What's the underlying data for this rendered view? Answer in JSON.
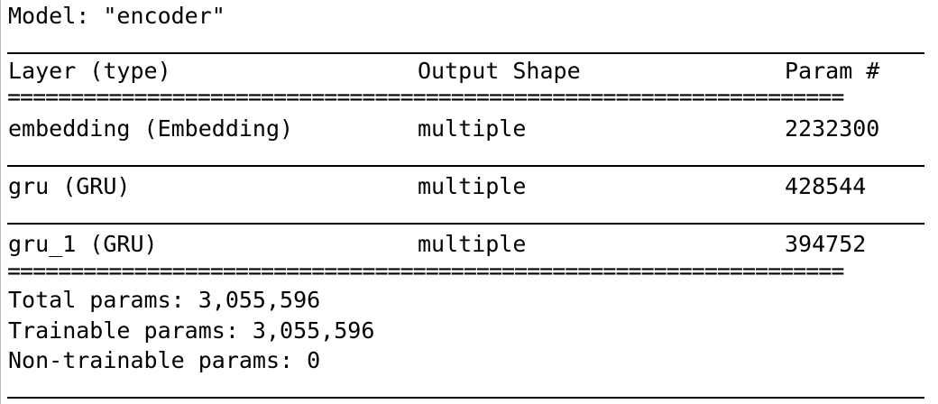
{
  "model_title": "Model: \"encoder\"",
  "table": {
    "headers": {
      "layer": "Layer (type)",
      "output_shape": "Output Shape",
      "params": "Param #"
    },
    "rows": [
      {
        "layer": "embedding (Embedding)",
        "output_shape": "multiple",
        "params": "2232300"
      },
      {
        "layer": "gru (GRU)",
        "output_shape": "multiple",
        "params": "428544"
      },
      {
        "layer": "gru_1 (GRU)",
        "output_shape": "multiple",
        "params": "394752"
      }
    ]
  },
  "summary": {
    "total": "Total params: 3,055,596",
    "trainable": "Trainable params: 3,055,596",
    "non_trainable": "Non-trainable params: 0"
  },
  "double_rule": "=================================================================="
}
